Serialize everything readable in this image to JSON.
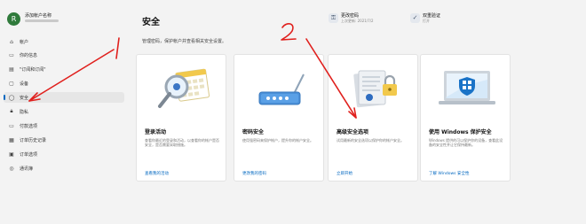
{
  "profile": {
    "avatar_letter": "R",
    "name": "添加帐户名称"
  },
  "nav": [
    {
      "label": "帐户",
      "icon": "user-icon"
    },
    {
      "label": "你的信息",
      "icon": "person-card-icon"
    },
    {
      "label": "\"订阅和订阅\"",
      "icon": "subscription-icon"
    },
    {
      "label": "设备",
      "icon": "devices-icon"
    },
    {
      "label": "安全",
      "icon": "shield-icon",
      "selected": true
    },
    {
      "label": "隐私",
      "icon": "lock-icon"
    },
    {
      "label": "付款选项",
      "icon": "card-icon"
    },
    {
      "label": "订单历史记录",
      "icon": "history-icon"
    },
    {
      "label": "订单选项",
      "icon": "order-icon"
    },
    {
      "label": "通讯簿",
      "icon": "contacts-icon"
    }
  ],
  "page": {
    "title": "安全",
    "description": "管理密码，保护帐户并查看相关安全设置。"
  },
  "quick": {
    "password": {
      "title": "更改密码",
      "subtitle": "上次更新: 2021/7/2",
      "icon": "key-icon"
    },
    "twostep": {
      "title": "双重验证",
      "subtitle": "打开",
      "icon": "shield-check-icon"
    }
  },
  "cards": [
    {
      "title": "登录活动",
      "desc": "查看你最近的登录和活动，以查看你的帐户是否安全，是否需要采取措施。",
      "link": "查看我的活动"
    },
    {
      "title": "密码安全",
      "desc": "使用强密码来保护帐户，提升你的帐户安全。",
      "link": "更改我的密码"
    },
    {
      "title": "高级安全选项",
      "desc": "试用最新的安全选项以保护你的帐户安全。",
      "link": "立即开始"
    },
    {
      "title": "使用 Windows 保护安全",
      "desc": "Windows 提供的可以保护你的设备，查看此设备的安全性并让它保持最新。",
      "link": "了解 Windows 安全性"
    }
  ],
  "annotations": {
    "mark1": "1",
    "mark2": "2"
  },
  "colors": {
    "accent": "#0067c0",
    "annotation": "#e0201d"
  }
}
